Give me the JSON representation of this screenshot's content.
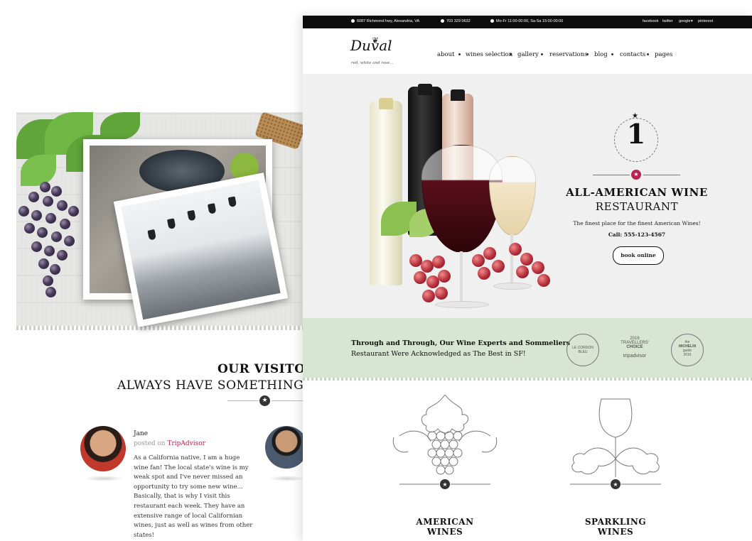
{
  "back_page": {
    "visitors": {
      "title": "OUR VISITOR",
      "subtitle": "ALWAYS HAVE SOMETHING NIC"
    },
    "review": {
      "name": "Jane",
      "posted_on_prefix": "posted on ",
      "source": "TripAdvisor",
      "text": "As a California native, I am a huge wine fan! The local state's wine is my weak spot and I've never missed an opportunity to try some new wine... Basically, that is why I visit this restaurant each week. They have an extensive range of local Californian wines, just as well as wines from other states!"
    }
  },
  "topbar": {
    "address": "6087 Richmond hwy, Alexandria, VA",
    "phone": "703 329 0632",
    "hours": "Mo-Fr 11:00-00:00, Sa-Sa 15:00-00:00",
    "social": [
      "facebook",
      "twitter",
      "google",
      "pinterest"
    ]
  },
  "logo": {
    "name": "Duval",
    "tagline": "red, white and rose..."
  },
  "nav": [
    "about",
    "wines selection",
    "gallery",
    "reservations",
    "blog",
    "contacts",
    "pages"
  ],
  "hero": {
    "award_number": "1",
    "title": "ALL-AMERICAN WINE",
    "subtitle": "RESTAURANT",
    "description": "The finest place for the finest American Wines!",
    "call": "Call: 555-123-4567",
    "button": "book online"
  },
  "awards": {
    "line1": "Through and Through, Our Wine Experts and Sommeliers",
    "line2": "Restaurant Were Acknowledged as The Best in SF!",
    "badges": {
      "cordon": "LE CORDON BLEU",
      "tripadvisor_year": "2016",
      "tripadvisor_line1": "TRAVELLERS'",
      "tripadvisor_line2": "CHOICE",
      "tripadvisor_brand": "tripadvisor",
      "michelin_line1": "the",
      "michelin_line2": "MICHELIN",
      "michelin_line3": "guide",
      "michelin_year": "2016"
    }
  },
  "sections": [
    {
      "line1": "AMERICAN",
      "line2": "WINES"
    },
    {
      "line1": "SPARKLING",
      "line2": "WINES"
    }
  ],
  "icons": {
    "star": "★",
    "location": "location-icon",
    "phone": "phone-icon",
    "clock": "clock-icon"
  },
  "colors": {
    "accent": "#b8244d",
    "band": "#d8e5d3",
    "topbar": "#0d0d0d"
  }
}
